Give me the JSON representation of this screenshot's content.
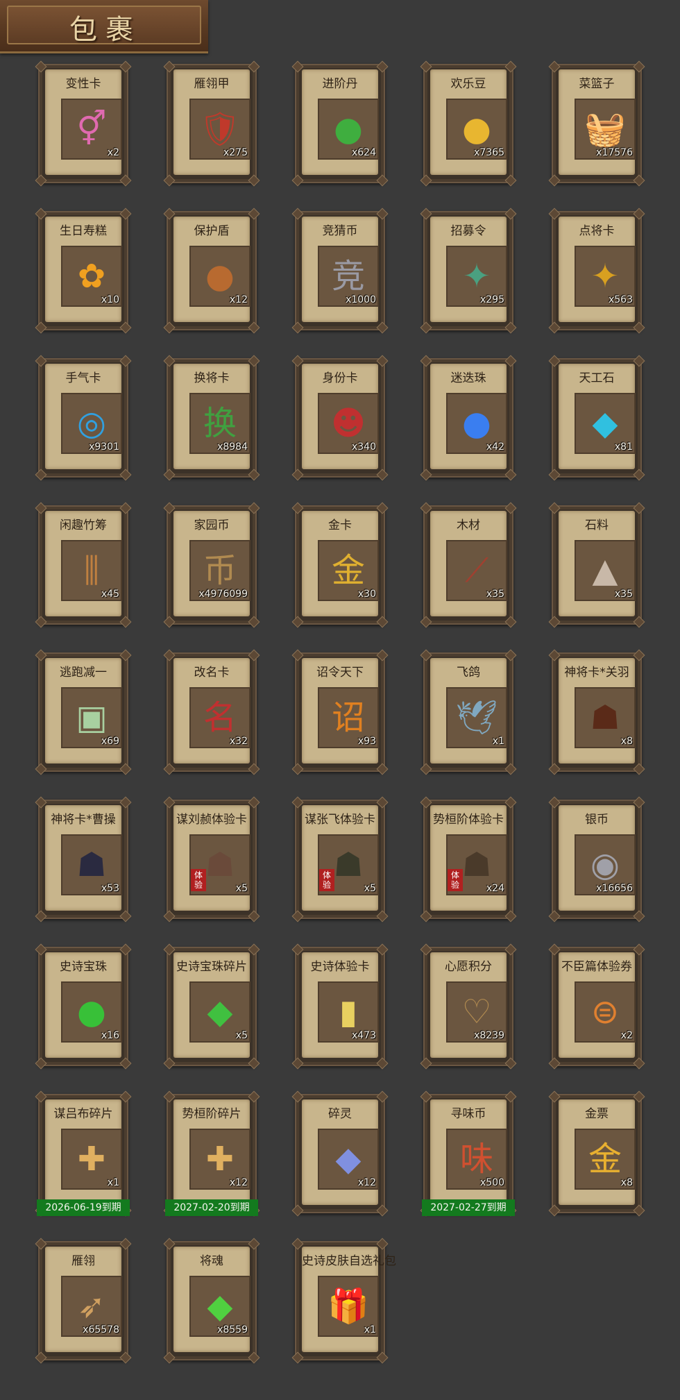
{
  "header": {
    "title": "包裹"
  },
  "items": [
    {
      "name": "变性卡",
      "qty": "x2",
      "icon": "gender-card-icon",
      "glyph": "⚥",
      "color": "#e06ab0"
    },
    {
      "name": "雁翎甲",
      "qty": "x275",
      "icon": "armor-icon",
      "glyph": "🛡",
      "color": "#c0392b"
    },
    {
      "name": "进阶丹",
      "qty": "x624",
      "icon": "green-pill-icon",
      "glyph": "●",
      "color": "#3fae3f"
    },
    {
      "name": "欢乐豆",
      "qty": "x7365",
      "icon": "gold-beans-icon",
      "glyph": "●",
      "color": "#e8b630"
    },
    {
      "name": "菜篮子",
      "qty": "x17576",
      "icon": "basket-icon",
      "glyph": "🧺",
      "color": "#c0392b"
    },
    {
      "name": "生日寿糕",
      "qty": "x10",
      "icon": "cake-icon",
      "glyph": "✿",
      "color": "#f0a020"
    },
    {
      "name": "保护盾",
      "qty": "x12",
      "icon": "shield-icon",
      "glyph": "●",
      "color": "#b86a30"
    },
    {
      "name": "竞猜币",
      "qty": "x1000",
      "icon": "silver-coin-icon",
      "glyph": "竞",
      "color": "#9a9aa4"
    },
    {
      "name": "招募令",
      "qty": "x295",
      "icon": "recruit-token-icon",
      "glyph": "✦",
      "color": "#4aa080"
    },
    {
      "name": "点将卡",
      "qty": "x563",
      "icon": "general-card-icon",
      "glyph": "✦",
      "color": "#d8a020"
    },
    {
      "name": "手气卡",
      "qty": "x9301",
      "icon": "luck-card-icon",
      "glyph": "◎",
      "color": "#30a0e0"
    },
    {
      "name": "换将卡",
      "qty": "x8984",
      "icon": "swap-card-icon",
      "glyph": "换",
      "color": "#40a040"
    },
    {
      "name": "身份卡",
      "qty": "x340",
      "icon": "identity-card-icon",
      "glyph": "☻",
      "color": "#c03030"
    },
    {
      "name": "迷迭珠",
      "qty": "x42",
      "icon": "blue-orb-icon",
      "glyph": "●",
      "color": "#3a7ef0"
    },
    {
      "name": "天工石",
      "qty": "x81",
      "icon": "crystal-icon",
      "glyph": "◆",
      "color": "#30c0e0"
    },
    {
      "name": "闲趣竹筹",
      "qty": "x45",
      "icon": "bamboo-tally-icon",
      "glyph": "⫼",
      "color": "#c08040"
    },
    {
      "name": "家园币",
      "qty": "x4976099",
      "icon": "home-coin-icon",
      "glyph": "币",
      "color": "#b08a50"
    },
    {
      "name": "金卡",
      "qty": "x30",
      "icon": "gold-card-icon",
      "glyph": "金",
      "color": "#e0b030"
    },
    {
      "name": "木材",
      "qty": "x35",
      "icon": "wood-icon",
      "glyph": "⟋",
      "color": "#a04030"
    },
    {
      "name": "石料",
      "qty": "x35",
      "icon": "stone-icon",
      "glyph": "▲",
      "color": "#c8b8a8"
    },
    {
      "name": "逃跑减一",
      "qty": "x69",
      "icon": "jade-tag-icon",
      "glyph": "▣",
      "color": "#a8d0a0"
    },
    {
      "name": "改名卡",
      "qty": "x32",
      "icon": "rename-card-icon",
      "glyph": "名",
      "color": "#c03030"
    },
    {
      "name": "诏令天下",
      "qty": "x93",
      "icon": "edict-scroll-icon",
      "glyph": "诏",
      "color": "#e08020"
    },
    {
      "name": "飞鸽",
      "qty": "x1",
      "icon": "pigeon-icon",
      "glyph": "🕊",
      "color": "#80a8c0"
    },
    {
      "name": "神将卡*关羽",
      "qty": "x8",
      "icon": "guanyu-portrait-icon",
      "glyph": "☗",
      "color": "#5a2a18"
    },
    {
      "name": "神将卡*曹操",
      "qty": "x53",
      "icon": "caocao-portrait-icon",
      "glyph": "☗",
      "color": "#2a2a40"
    },
    {
      "name": "谋刘赪体验卡",
      "qty": "x5",
      "icon": "liu-portrait-icon",
      "glyph": "☗",
      "color": "#6a4a3a",
      "trial": "体验"
    },
    {
      "name": "谋张飞体验卡",
      "qty": "x5",
      "icon": "zhangfei-portrait-icon",
      "glyph": "☗",
      "color": "#3a3a2a",
      "trial": "体验"
    },
    {
      "name": "势桓阶体验卡",
      "qty": "x24",
      "icon": "huanjie-portrait-icon",
      "glyph": "☗",
      "color": "#4a3a2a",
      "trial": "体验"
    },
    {
      "name": "银币",
      "qty": "x16656",
      "icon": "silver-coins-icon",
      "glyph": "◉",
      "color": "#a0a0a8"
    },
    {
      "name": "史诗宝珠",
      "qty": "x16",
      "icon": "epic-orb-icon",
      "glyph": "●",
      "color": "#38c038"
    },
    {
      "name": "史诗宝珠碎片",
      "qty": "x5",
      "icon": "epic-shard-icon",
      "glyph": "◆",
      "color": "#40c040"
    },
    {
      "name": "史诗体验卡",
      "qty": "x473",
      "icon": "epic-trial-card-icon",
      "glyph": "▮",
      "color": "#e8d060"
    },
    {
      "name": "心愿积分",
      "qty": "x8239",
      "icon": "wish-coin-icon",
      "glyph": "♡",
      "color": "#b08a50"
    },
    {
      "name": "不臣篇体验券",
      "qty": "x2",
      "icon": "ticket-icon",
      "glyph": "⊜",
      "color": "#e08030"
    },
    {
      "name": "谋吕布碎片",
      "qty": "x1",
      "icon": "lubu-shard-icon",
      "glyph": "✚",
      "color": "#e0b060",
      "expiry": "2026-06-19到期"
    },
    {
      "name": "势桓阶碎片",
      "qty": "x12",
      "icon": "huanjie-shard-icon",
      "glyph": "✚",
      "color": "#e0b060",
      "expiry": "2027-02-20到期"
    },
    {
      "name": "碎灵",
      "qty": "x12",
      "icon": "soul-crystal-icon",
      "glyph": "◆",
      "color": "#8090e0"
    },
    {
      "name": "寻味币",
      "qty": "x500",
      "icon": "taste-coin-icon",
      "glyph": "味",
      "color": "#d05030",
      "expiry": "2027-02-27到期"
    },
    {
      "name": "金票",
      "qty": "x8",
      "icon": "gold-ticket-icon",
      "glyph": "金",
      "color": "#e8b030"
    },
    {
      "name": "雁翎",
      "qty": "x65578",
      "icon": "feather-icon",
      "glyph": "➶",
      "color": "#d0a060"
    },
    {
      "name": "将魂",
      "qty": "x8559",
      "icon": "general-soul-icon",
      "glyph": "◆",
      "color": "#50d040"
    },
    {
      "name": "史诗皮肤自选礼包",
      "qty": "x1",
      "icon": "gift-box-icon",
      "glyph": "🎁",
      "color": "#3060d0"
    }
  ]
}
